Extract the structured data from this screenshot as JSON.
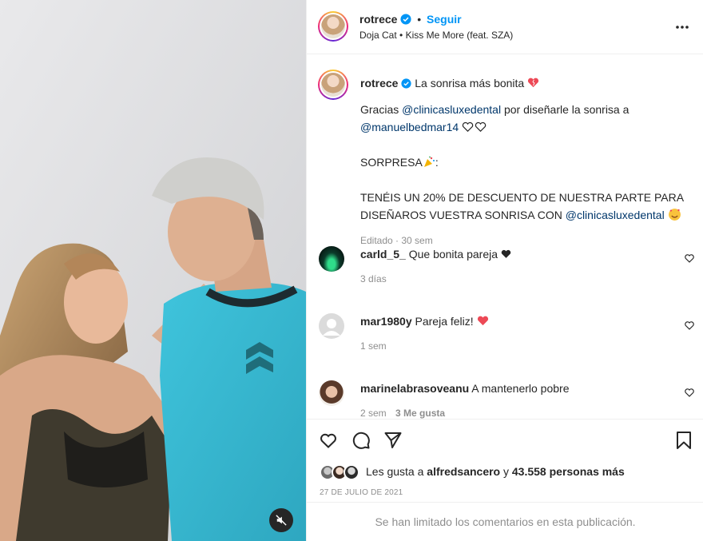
{
  "header": {
    "username": "rotrece",
    "separator": "•",
    "follow_label": "Seguir",
    "audio_artist": "Doja Cat",
    "audio_dot": "•",
    "audio_track": "Kiss Me More (feat. SZA)"
  },
  "caption": {
    "username": "rotrece",
    "line1": "La sonrisa más bonita",
    "line2_pre": "Gracias",
    "line2_mention": "@clinicasluxedental",
    "line2_post": "por diseñarle la sonrisa a",
    "line3_mention": "@manuelbedmar14",
    "line4": "SORPRESA",
    "line4_post": ":",
    "line5": "TENÉIS UN 20% DE DESCUENTO DE NUESTRA PARTE PARA",
    "line6_pre": "DISEÑAROS VUESTRA SONRISA CON",
    "line6_mention": "@clinicasluxedental",
    "meta": "Editado · 30 sem"
  },
  "comments": [
    {
      "username": "carld_5_",
      "text": "Que bonita pareja",
      "time": "3 días",
      "likes": ""
    },
    {
      "username": "mar1980y",
      "text": "Pareja feliz!",
      "time": "1 sem",
      "likes": ""
    },
    {
      "username": "marinelabrasoveanu",
      "text": "A mantenerlo pobre",
      "time": "2 sem",
      "likes": "3 Me gusta"
    }
  ],
  "likes": {
    "prefix": "Les gusta a",
    "user": "alfredsancero",
    "middle": "y",
    "count": "43.558 personas más"
  },
  "date": "27 DE JULIO DE 2021",
  "comments_limited": "Se han limitado los comentarios en esta publicación.",
  "colors": {
    "accent": "#0095f6",
    "heart_red": "#ed4956",
    "shirt": "#35b8d0"
  },
  "icons": [
    "verified-icon",
    "more-icon",
    "heart-icon",
    "comment-icon",
    "share-icon",
    "bookmark-icon",
    "mute-icon"
  ]
}
